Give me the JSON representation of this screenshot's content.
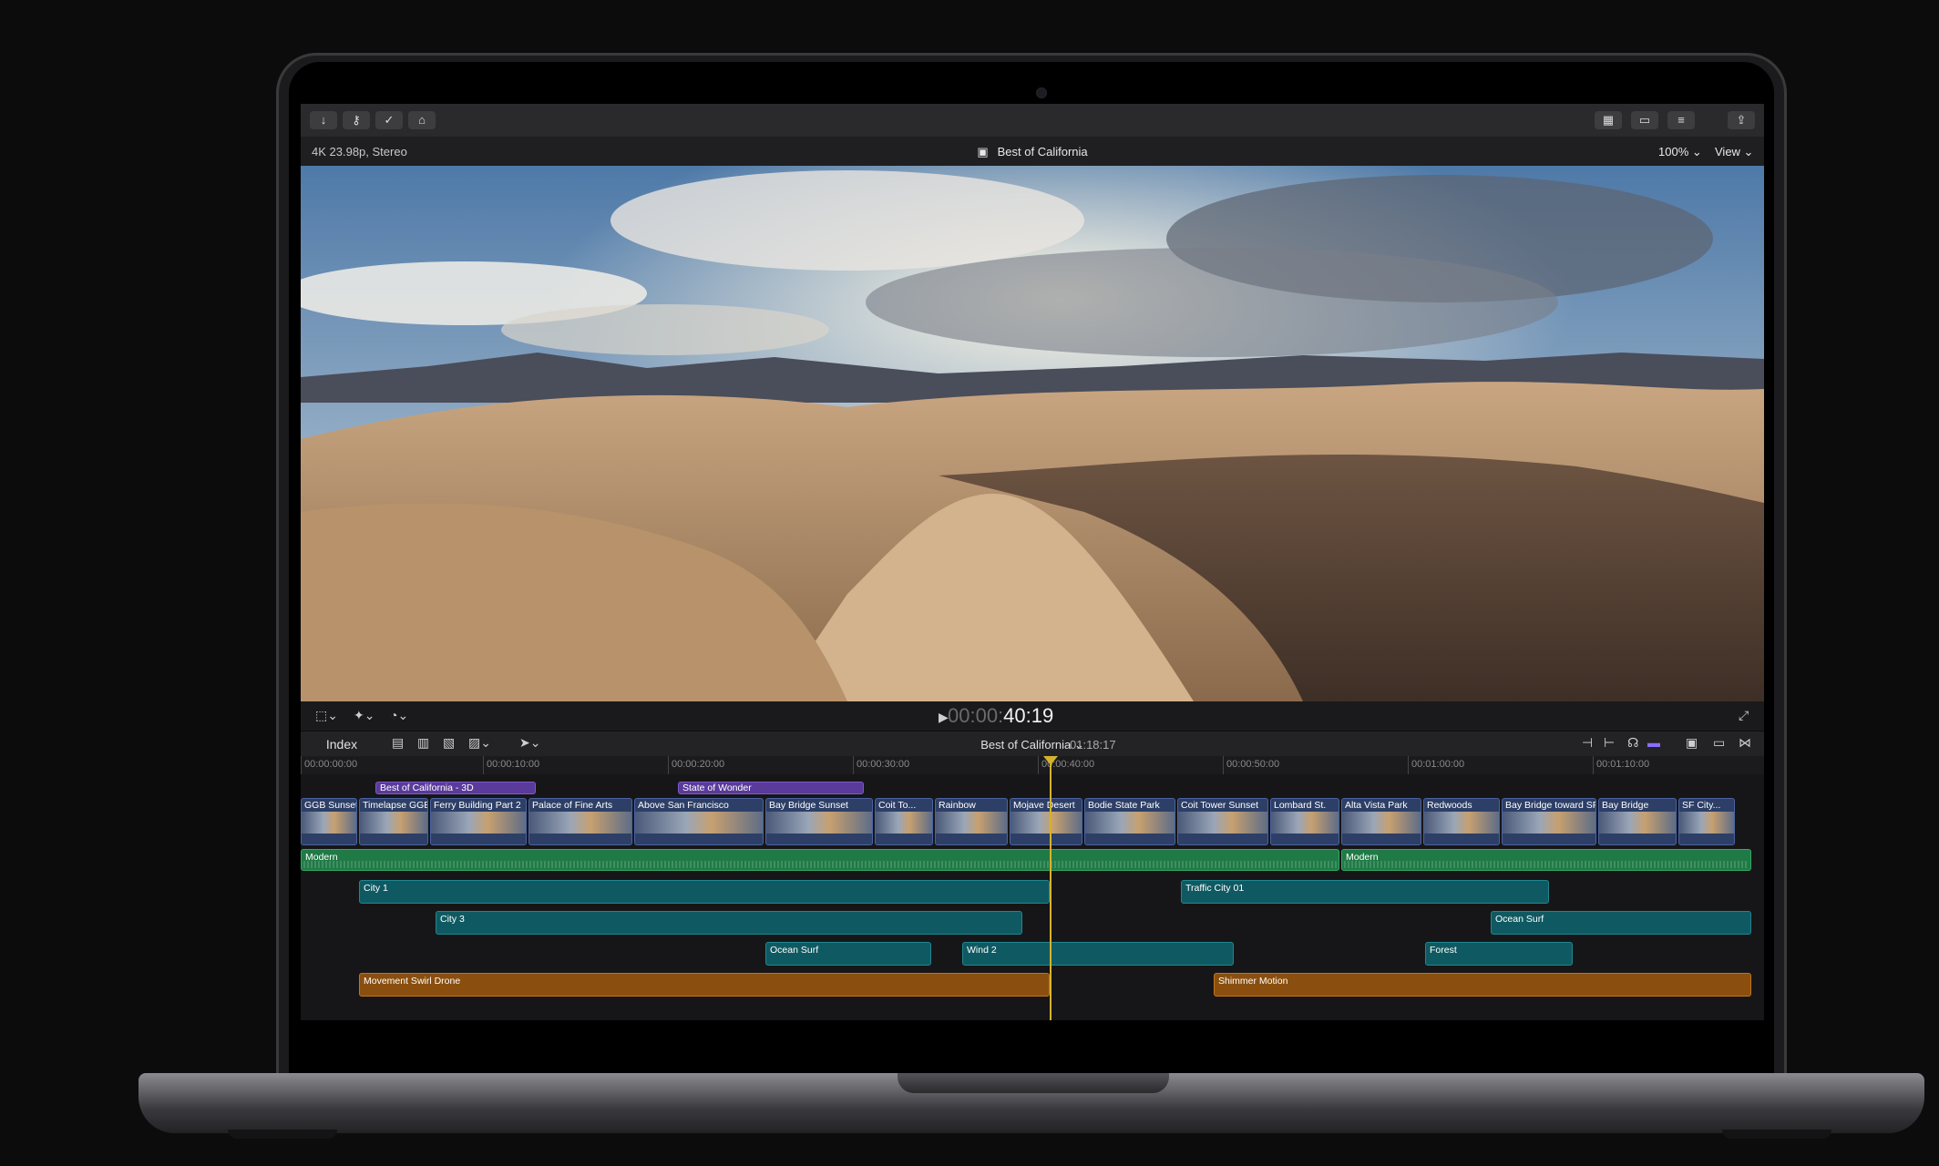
{
  "toolbar": {
    "left_icons": [
      "import-icon",
      "key-icon",
      "check-icon",
      "tag-icon"
    ],
    "right_icons": [
      "grid-icon",
      "filmstrip-icon",
      "sliders-icon",
      "share-icon"
    ]
  },
  "infobar": {
    "format": "4K 23.98p, Stereo",
    "project_title": "Best of California",
    "zoom": "100% ⌄",
    "view": "View ⌄"
  },
  "transport": {
    "timecode_dim": "00:00:",
    "timecode_main": "40:19"
  },
  "timeline_header": {
    "index_label": "Index",
    "title": "Best of California ⌄",
    "duration": "01:18:17"
  },
  "ruler": {
    "ticks": [
      "00:00:00:00",
      "00:00:10:00",
      "00:00:20:00",
      "00:00:30:00",
      "00:00:40:00",
      "00:00:50:00",
      "00:01:00:00",
      "00:01:10:00"
    ]
  },
  "titles": [
    "Best of California - 3D",
    "State of Wonder"
  ],
  "video_clips": [
    "GGB Sunset",
    "Timelapse GGB",
    "Ferry Building Part 2",
    "Palace of Fine Arts",
    "Above San Francisco",
    "Bay Bridge Sunset",
    "Coit To...",
    "Rainbow",
    "Mojave Desert",
    "Bodie State Park",
    "Coit Tower Sunset",
    "Lombard St.",
    "Alta Vista Park",
    "Redwoods",
    "Bay Bridge toward SF",
    "Bay Bridge",
    "SF City..."
  ],
  "audio_music": [
    "Modern",
    "Modern"
  ],
  "audio_clips": {
    "city1": "City 1",
    "traffic": "Traffic City 01",
    "city3": "City 3",
    "ocean_surf_right": "Ocean Surf",
    "ocean_surf_left": "Ocean Surf",
    "wind2": "Wind 2",
    "forest": "Forest",
    "swirl": "Movement Swirl Drone",
    "shimmer": "Shimmer Motion"
  },
  "colors": {
    "title_clip": "#5a3a9a",
    "video_clip": "#2d3f66",
    "music_clip": "#1f7a45",
    "audio_clip": "#0f5a62",
    "sfx_clip": "#8a4f0e",
    "playhead": "#d6b22c"
  }
}
